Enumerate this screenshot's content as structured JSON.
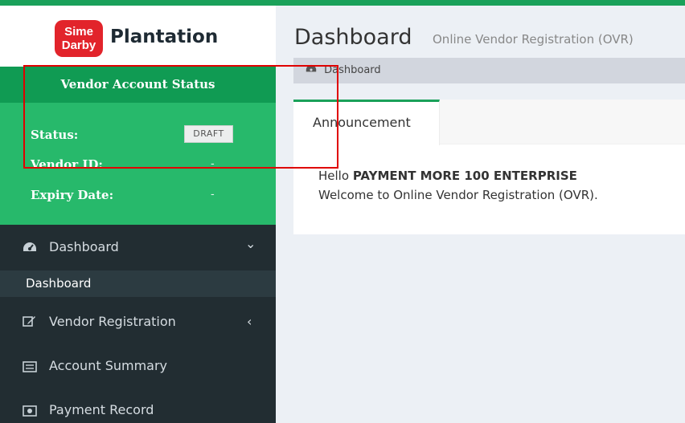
{
  "brand": {
    "badge_line1": "Sime",
    "badge_line2": "Darby",
    "name": "Plantation"
  },
  "vendor_status": {
    "heading": "Vendor Account Status",
    "status_label": "Status:",
    "status_value": "DRAFT",
    "vendor_id_label": "Vendor ID:",
    "vendor_id_value": "-",
    "expiry_label": "Expiry Date:",
    "expiry_value": "-"
  },
  "sidebar": {
    "items": [
      {
        "label": "Dashboard",
        "icon": "dashboard-icon",
        "caret": "⌄"
      },
      {
        "label": "Dashboard"
      },
      {
        "label": "Vendor Registration",
        "icon": "edit-icon",
        "caret": "‹"
      },
      {
        "label": "Account Summary",
        "icon": "list-icon"
      },
      {
        "label": "Payment Record",
        "icon": "money-icon"
      }
    ]
  },
  "header": {
    "title": "Dashboard",
    "subtitle": "Online Vendor Registration (OVR)"
  },
  "breadcrumb": {
    "label": "Dashboard"
  },
  "tabs": [
    {
      "label": "Announcement"
    }
  ],
  "announcement": {
    "hello_prefix": "Hello",
    "company": "PAYMENT MORE 100 ENTERPRISE",
    "welcome": "Welcome to Online Vendor Registration (OVR)."
  },
  "colors": {
    "brand_green": "#1aa15a",
    "status_green": "#27b96b",
    "sidebar_dark": "#222d32",
    "annotation_red": "#e00000"
  }
}
